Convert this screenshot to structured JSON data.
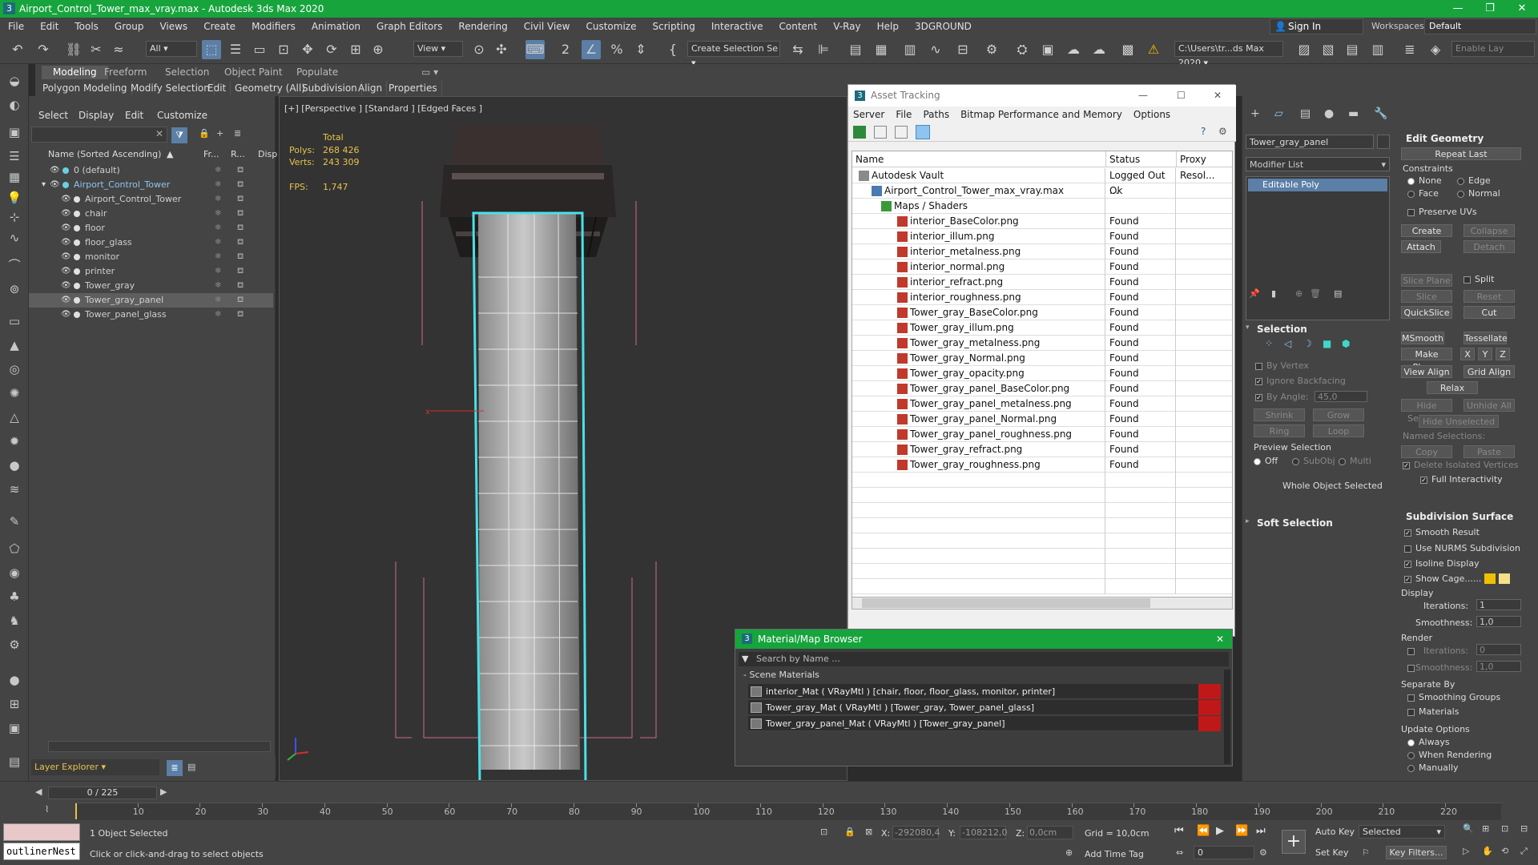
{
  "window": {
    "title": "Airport_Control_Tower_max_vray.max - Autodesk 3ds Max 2020",
    "app_icon": "3"
  },
  "menu": [
    "File",
    "Edit",
    "Tools",
    "Group",
    "Views",
    "Create",
    "Modifiers",
    "Animation",
    "Graph Editors",
    "Rendering",
    "Civil View",
    "Customize",
    "Scripting",
    "Interactive",
    "Content",
    "V-Ray",
    "Help",
    "3DGROUND"
  ],
  "signin": "Sign In",
  "workspaces_label": "Workspaces:",
  "workspace": "Default",
  "toolbar": {
    "filter": "All",
    "view": "View",
    "selection_set": "Create Selection Se",
    "path": "C:\\Users\\tr...ds Max 2020",
    "enable": "Enable Lay"
  },
  "ribbon": {
    "tabs": [
      "Modeling",
      "Freeform",
      "Selection",
      "Object Paint",
      "Populate"
    ],
    "sub": [
      "Polygon Modeling",
      "Modify Selection",
      "Edit",
      "Geometry (All)",
      "Subdivision",
      "Align",
      "Properties"
    ]
  },
  "scene": {
    "menu": [
      "Select",
      "Display",
      "Edit",
      "Customize"
    ],
    "cols": {
      "name": "Name (Sorted Ascending)",
      "fr": "Fr...",
      "r": "R...",
      "disp": "Disp"
    },
    "rows": [
      {
        "name": "0 (default)",
        "indent": 0
      },
      {
        "name": "Airport_Control_Tower",
        "indent": 1,
        "highlight": true
      },
      {
        "name": "Airport_Control_Tower",
        "indent": 2
      },
      {
        "name": "chair",
        "indent": 2
      },
      {
        "name": "floor",
        "indent": 2
      },
      {
        "name": "floor_glass",
        "indent": 2
      },
      {
        "name": "monitor",
        "indent": 2
      },
      {
        "name": "printer",
        "indent": 2
      },
      {
        "name": "Tower_gray",
        "indent": 2
      },
      {
        "name": "Tower_gray_panel",
        "indent": 2,
        "selected": true
      },
      {
        "name": "Tower_panel_glass",
        "indent": 2
      }
    ],
    "layer": "Layer Explorer"
  },
  "viewport": {
    "label": "[+] [Perspective ] [Standard ] [Edged Faces ]",
    "total": "Total",
    "polys_label": "Polys:",
    "polys": "268 426",
    "verts_label": "Verts:",
    "verts": "243 309",
    "fps_label": "FPS:",
    "fps": "1,747"
  },
  "asset": {
    "title": "Asset Tracking",
    "icon": "3",
    "menu": [
      "Server",
      "File",
      "Paths",
      "Bitmap Performance and Memory",
      "Options"
    ],
    "cols": {
      "name": "Name",
      "status": "Status",
      "proxy": "Proxy Resol..."
    },
    "rows": [
      {
        "name": "Autodesk Vault",
        "status": "Logged Out ...",
        "indent": 0,
        "type": "vault"
      },
      {
        "name": "Airport_Control_Tower_max_vray.max",
        "status": "Ok",
        "indent": 1,
        "type": "file"
      },
      {
        "name": "Maps / Shaders",
        "status": "",
        "indent": 2,
        "type": "folder"
      },
      {
        "name": "interior_BaseColor.png",
        "status": "Found",
        "indent": 3
      },
      {
        "name": "interior_illum.png",
        "status": "Found",
        "indent": 3
      },
      {
        "name": "interior_metalness.png",
        "status": "Found",
        "indent": 3
      },
      {
        "name": "interior_normal.png",
        "status": "Found",
        "indent": 3
      },
      {
        "name": "interior_refract.png",
        "status": "Found",
        "indent": 3
      },
      {
        "name": "interior_roughness.png",
        "status": "Found",
        "indent": 3
      },
      {
        "name": "Tower_gray_BaseColor.png",
        "status": "Found",
        "indent": 3
      },
      {
        "name": "Tower_gray_illum.png",
        "status": "Found",
        "indent": 3
      },
      {
        "name": "Tower_gray_metalness.png",
        "status": "Found",
        "indent": 3
      },
      {
        "name": "Tower_gray_Normal.png",
        "status": "Found",
        "indent": 3
      },
      {
        "name": "Tower_gray_opacity.png",
        "status": "Found",
        "indent": 3
      },
      {
        "name": "Tower_gray_panel_BaseColor.png",
        "status": "Found",
        "indent": 3
      },
      {
        "name": "Tower_gray_panel_metalness.png",
        "status": "Found",
        "indent": 3
      },
      {
        "name": "Tower_gray_panel_Normal.png",
        "status": "Found",
        "indent": 3
      },
      {
        "name": "Tower_gray_panel_roughness.png",
        "status": "Found",
        "indent": 3
      },
      {
        "name": "Tower_gray_refract.png",
        "status": "Found",
        "indent": 3
      },
      {
        "name": "Tower_gray_roughness.png",
        "status": "Found",
        "indent": 3
      }
    ]
  },
  "matbrowser": {
    "title": "Material/Map Browser",
    "icon": "3",
    "search": "Search by Name ...",
    "group": "- Scene Materials",
    "items": [
      "interior_Mat  ( VRayMtl ) [chair, floor, floor_glass, monitor, printer]",
      "Tower_gray_Mat  ( VRayMtl ) [Tower_gray, Tower_panel_glass]",
      "Tower_gray_panel_Mat  ( VRayMtl ) [Tower_gray_panel]"
    ]
  },
  "cmd": {
    "objname": "Tower_gray_panel",
    "modlist": "Modifier List",
    "modifier": "Editable Poly",
    "editgeom": "Edit Geometry",
    "repeat": "Repeat Last",
    "constraints": "Constraints",
    "c_none": "None",
    "c_edge": "Edge",
    "c_face": "Face",
    "c_normal": "Normal",
    "preserve": "Preserve UVs",
    "create": "Create",
    "collapse": "Collapse",
    "attach": "Attach",
    "detach": "Detach",
    "slice_plane": "Slice Plane",
    "split": "Split",
    "slice": "Slice",
    "reset_plane": "Reset Plane",
    "quickslice": "QuickSlice",
    "cut": "Cut",
    "msmooth": "MSmooth",
    "tessellate": "Tessellate",
    "make_planar": "Make Planar",
    "x": "X",
    "y": "Y",
    "z": "Z",
    "view_align": "View Align",
    "grid_align": "Grid Align",
    "relax": "Relax",
    "hide_sel": "Hide Selected",
    "unhide_all": "Unhide All",
    "hide_unsel": "Hide Unselected",
    "named_sel": "Named Selections:",
    "copy": "Copy",
    "paste": "Paste",
    "del_iso": "Delete Isolated Vertices",
    "full_int": "Full Interactivity",
    "subdiv": "Subdivision Surface",
    "smooth_result": "Smooth Result",
    "use_nurms": "Use NURMS Subdivision",
    "isoline": "Isoline Display",
    "show_cage": "Show Cage......",
    "display": "Display",
    "iterations": "Iterations:",
    "iter_val": "1",
    "smoothness": "Smoothness:",
    "smooth_val": "1,0",
    "render": "Render",
    "r_iter": "0",
    "r_smooth": "1,0",
    "separate": "Separate By",
    "smoothing_groups": "Smoothing Groups",
    "materials": "Materials",
    "update": "Update Options",
    "always": "Always",
    "when_render": "When Rendering",
    "manually": "Manually",
    "selection": "Selection",
    "by_vertex": "By Vertex",
    "ignore_bf": "Ignore Backfacing",
    "by_angle": "By Angle:",
    "angle": "45,0",
    "shrink": "Shrink",
    "grow": "Grow",
    "ring": "Ring",
    "loop": "Loop",
    "preview": "Preview Selection",
    "off": "Off",
    "subobj": "SubObj",
    "multi": "Multi",
    "whole": "Whole Object Selected",
    "soft": "Soft Selection"
  },
  "status": {
    "frame": "0 / 225",
    "ticks": [
      "10",
      "20",
      "30",
      "40",
      "50",
      "60",
      "70",
      "80",
      "90",
      "100",
      "110",
      "120",
      "130",
      "140",
      "150",
      "160",
      "170",
      "180",
      "190",
      "200",
      "210",
      "220"
    ],
    "selected": "1 Object Selected",
    "hint": "Click or click-and-drag to select objects",
    "script": "outlinerNest",
    "x_label": "X:",
    "x": "-292080,4",
    "y_label": "Y:",
    "y": "-108212,0",
    "z_label": "Z:",
    "z": "0,0cm",
    "grid": "Grid = 10,0cm",
    "add_time_tag": "Add Time Tag",
    "auto_key": "Auto Key",
    "selected_dd": "Selected",
    "set_key": "Set Key",
    "key_filters": "Key Filters...",
    "frame_val": "0"
  },
  "colors": {
    "title": "#17a43d",
    "cage": "#4ae0e8",
    "stat": "#e8c24a"
  }
}
